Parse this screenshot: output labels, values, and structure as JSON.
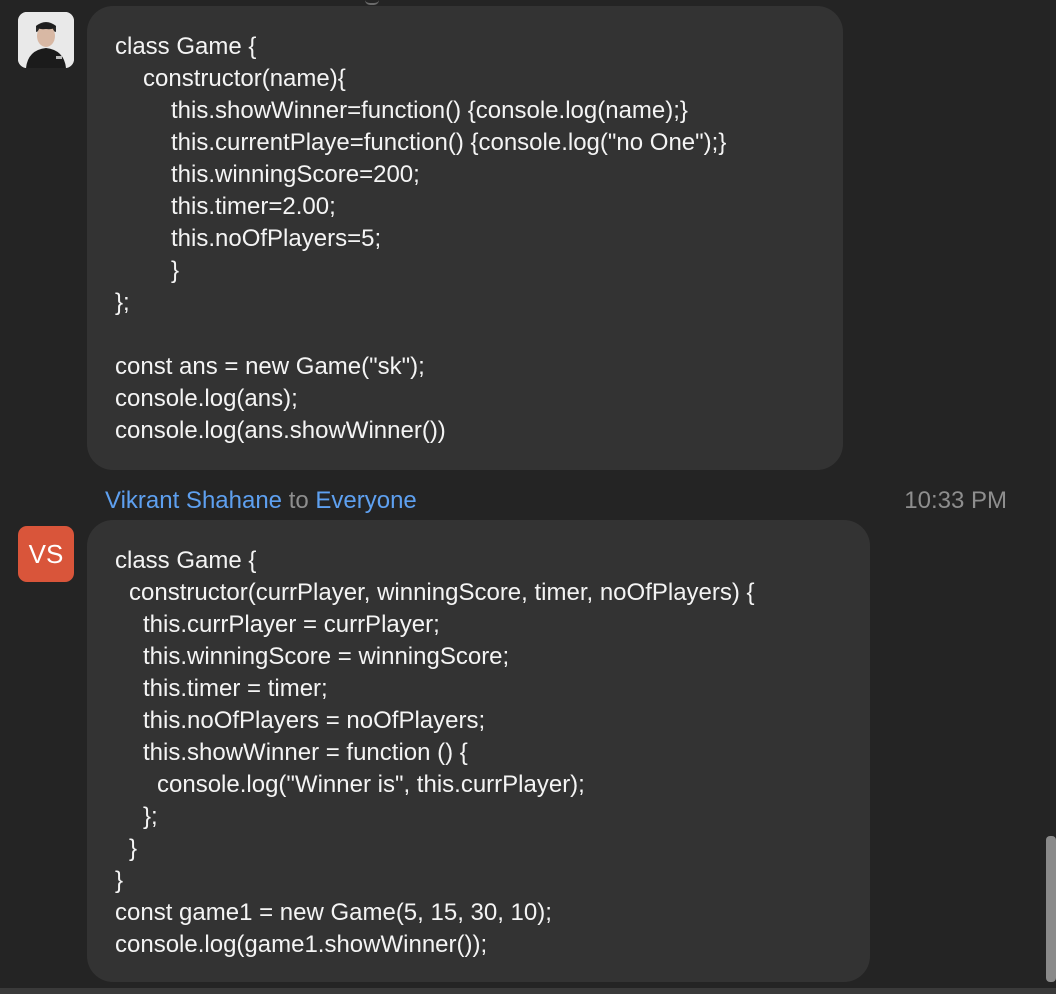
{
  "messages": [
    {
      "avatar_icon": "user-photo",
      "code_lines": [
        "class Game {",
        "constructor(name){",
        "this.showWinner=function() {console.log(name);}",
        "this.currentPlaye=function() {console.log(\"no One\");}",
        "this.winningScore=200;",
        "this.timer=2.00;",
        "this.noOfPlayers=5;",
        "}",
        "};",
        "",
        "const ans = new Game(\"sk\");",
        "console.log(ans);",
        "console.log(ans.showWinner())"
      ]
    },
    {
      "sender": "Vikrant Shahane",
      "to_text": "to",
      "recipient": "Everyone",
      "time": "10:33 PM",
      "avatar_initials": "VS",
      "code_lines": [
        "class Game {",
        "constructor(currPlayer, winningScore, timer, noOfPlayers) {",
        "this.currPlayer = currPlayer;",
        "this.winningScore = winningScore;",
        "this.timer = timer;",
        "this.noOfPlayers = noOfPlayers;",
        "this.showWinner = function () {",
        "console.log(\"Winner is\", this.currPlayer);",
        "};",
        "}",
        "}",
        "const game1 = new Game(5, 15, 30, 10);",
        "console.log(game1.showWinner());"
      ]
    }
  ],
  "colors": {
    "background": "#242424",
    "bubble": "#333333",
    "sender_link": "#5ea0f0",
    "avatar_vs": "#d9553a"
  }
}
